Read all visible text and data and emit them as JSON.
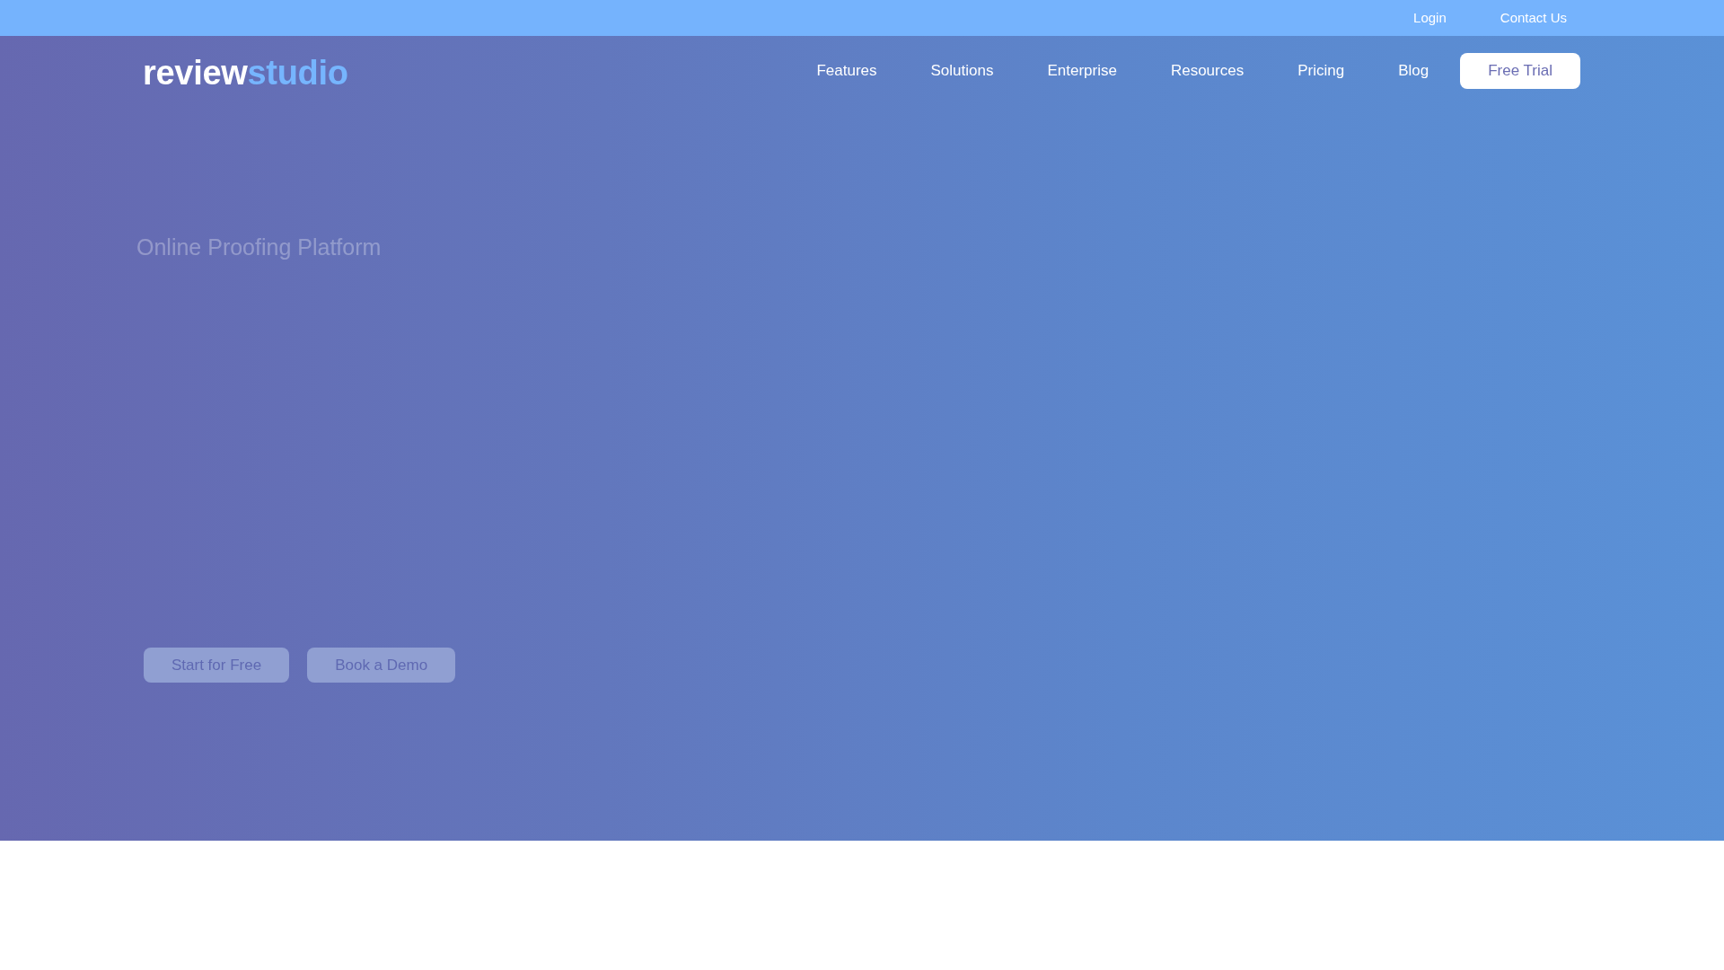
{
  "top_bar": {
    "links": [
      "Login",
      "Contact Us"
    ]
  },
  "header": {
    "logo": {
      "parts": [
        "review",
        "studio"
      ]
    },
    "nav": [
      "Features",
      "Solutions",
      "Enterprise",
      "Resources",
      "Pricing",
      "Blog"
    ],
    "cta": "Free Trial"
  },
  "hero": {
    "eyebrow": "Online Proofing Platform",
    "buttons": [
      "Start for Free",
      "Book a Demo"
    ]
  }
}
